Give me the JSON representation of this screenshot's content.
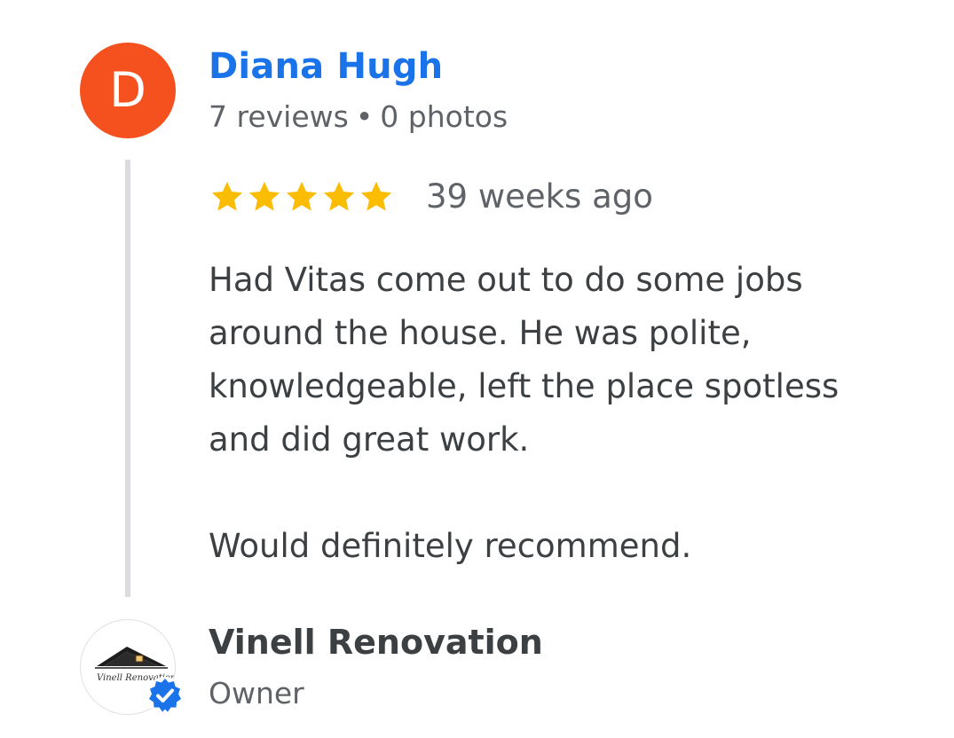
{
  "reviewer": {
    "initial": "D",
    "name": "Diana Hugh",
    "reviews_count": "7 reviews",
    "separator": "•",
    "photos_count": "0 photos",
    "avatar_color": "#f4511e"
  },
  "review": {
    "rating": 5,
    "max_rating": 5,
    "star_color": "#fbbc04",
    "time": "39 weeks ago",
    "paragraphs": [
      "Had Vitas come out to do some jobs around the house. He was polite, knowledgeable, left the place spotless and did great work.",
      "Would definitely recommend."
    ]
  },
  "owner": {
    "name": "Vinell Renovation",
    "role": "Owner",
    "logo_icon": "house-roof-logo-icon",
    "logo_text": "Vinell Renovations",
    "verified_icon": "verified-badge-icon",
    "verified_color": "#1a73e8"
  },
  "colors": {
    "link_blue": "#1a73e8",
    "text_dark": "#3c4043",
    "text_muted": "#5f6368",
    "thread_line": "#dadce0"
  }
}
